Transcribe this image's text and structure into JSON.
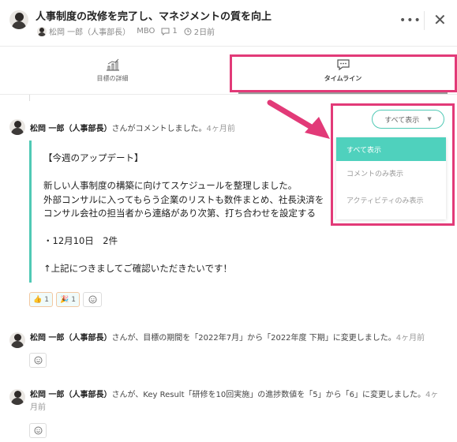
{
  "header": {
    "title": "人事制度の改修を完了し、マネジメントの質を向上",
    "owner": "松岡 一郎（人事部長）",
    "category": "MBO",
    "comment_count": "1",
    "updated": "2日前",
    "more_icon": "more-icon",
    "close_icon": "close-icon"
  },
  "tabs": [
    {
      "label": "目標の詳細",
      "icon": "bar-chart-icon"
    },
    {
      "label": "タイムライン",
      "icon": "chat-bubble-icon"
    }
  ],
  "filter": {
    "selected": "すべて表示",
    "options": [
      "すべて表示",
      "コメントのみ表示",
      "アクティビティのみ表示"
    ]
  },
  "comment": {
    "author": "松岡 一郎（人事部長）",
    "verb": "さんがコメントしました。",
    "ago": "4ヶ月前",
    "lines": [
      "【今週のアップデート】",
      "",
      "新しい人事制度の構築に向けてスケジュールを整理しました。",
      "外部コンサルに入ってもらう企業のリストも数件まとめ、社長決済を",
      "コンサル会社の担当者から連絡があり次第、打ち合わせを設定する",
      "",
      "・12月10日　2件",
      "",
      "↑上記につきましてご確認いただきたいです！"
    ],
    "reactions": [
      {
        "emoji": "👍",
        "count": "1"
      },
      {
        "emoji": "🎉",
        "count": "1"
      }
    ]
  },
  "activities": [
    {
      "author": "松岡 一郎（人事部長）",
      "text": "さんが、目標の期間を「2022年7月」から「2022年度 下期」に変更しました。",
      "ago": "4ヶ月前"
    },
    {
      "author": "松岡 一郎（人事部長）",
      "text": "さんが、Key Result「研修を10回実施」の進捗数値を「5」から「6」に変更しました。",
      "ago": "4ヶ月前"
    }
  ],
  "colors": {
    "accent": "#4fd1bd",
    "highlight": "#e23a78"
  }
}
